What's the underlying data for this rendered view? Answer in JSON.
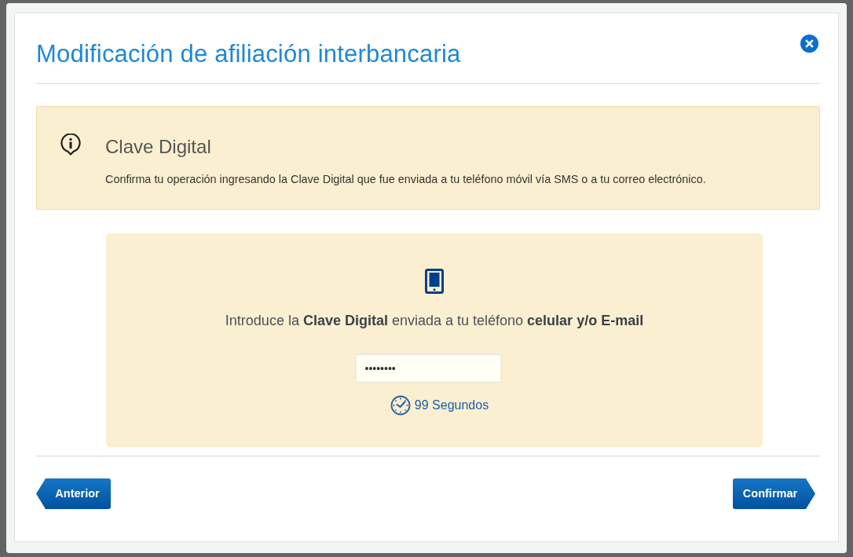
{
  "modal": {
    "title": "Modificación de afiliación interbancaria"
  },
  "notice": {
    "heading": "Clave Digital",
    "text": "Confirma tu operación ingresando la Clave Digital que fue enviada a tu teléfono móvil vía SMS o a tu correo electrónico."
  },
  "code_panel": {
    "prompt": "Introduce la **Clave Digital** enviada a tu teléfono **celular y/o E-mail**",
    "code_field": {
      "value": "••••••••"
    },
    "countdown": "99 Segundos"
  },
  "buttons": [
    {
      "label": "Anterior",
      "kind": "back"
    },
    {
      "label": "Confirmar",
      "kind": "next"
    }
  ]
}
